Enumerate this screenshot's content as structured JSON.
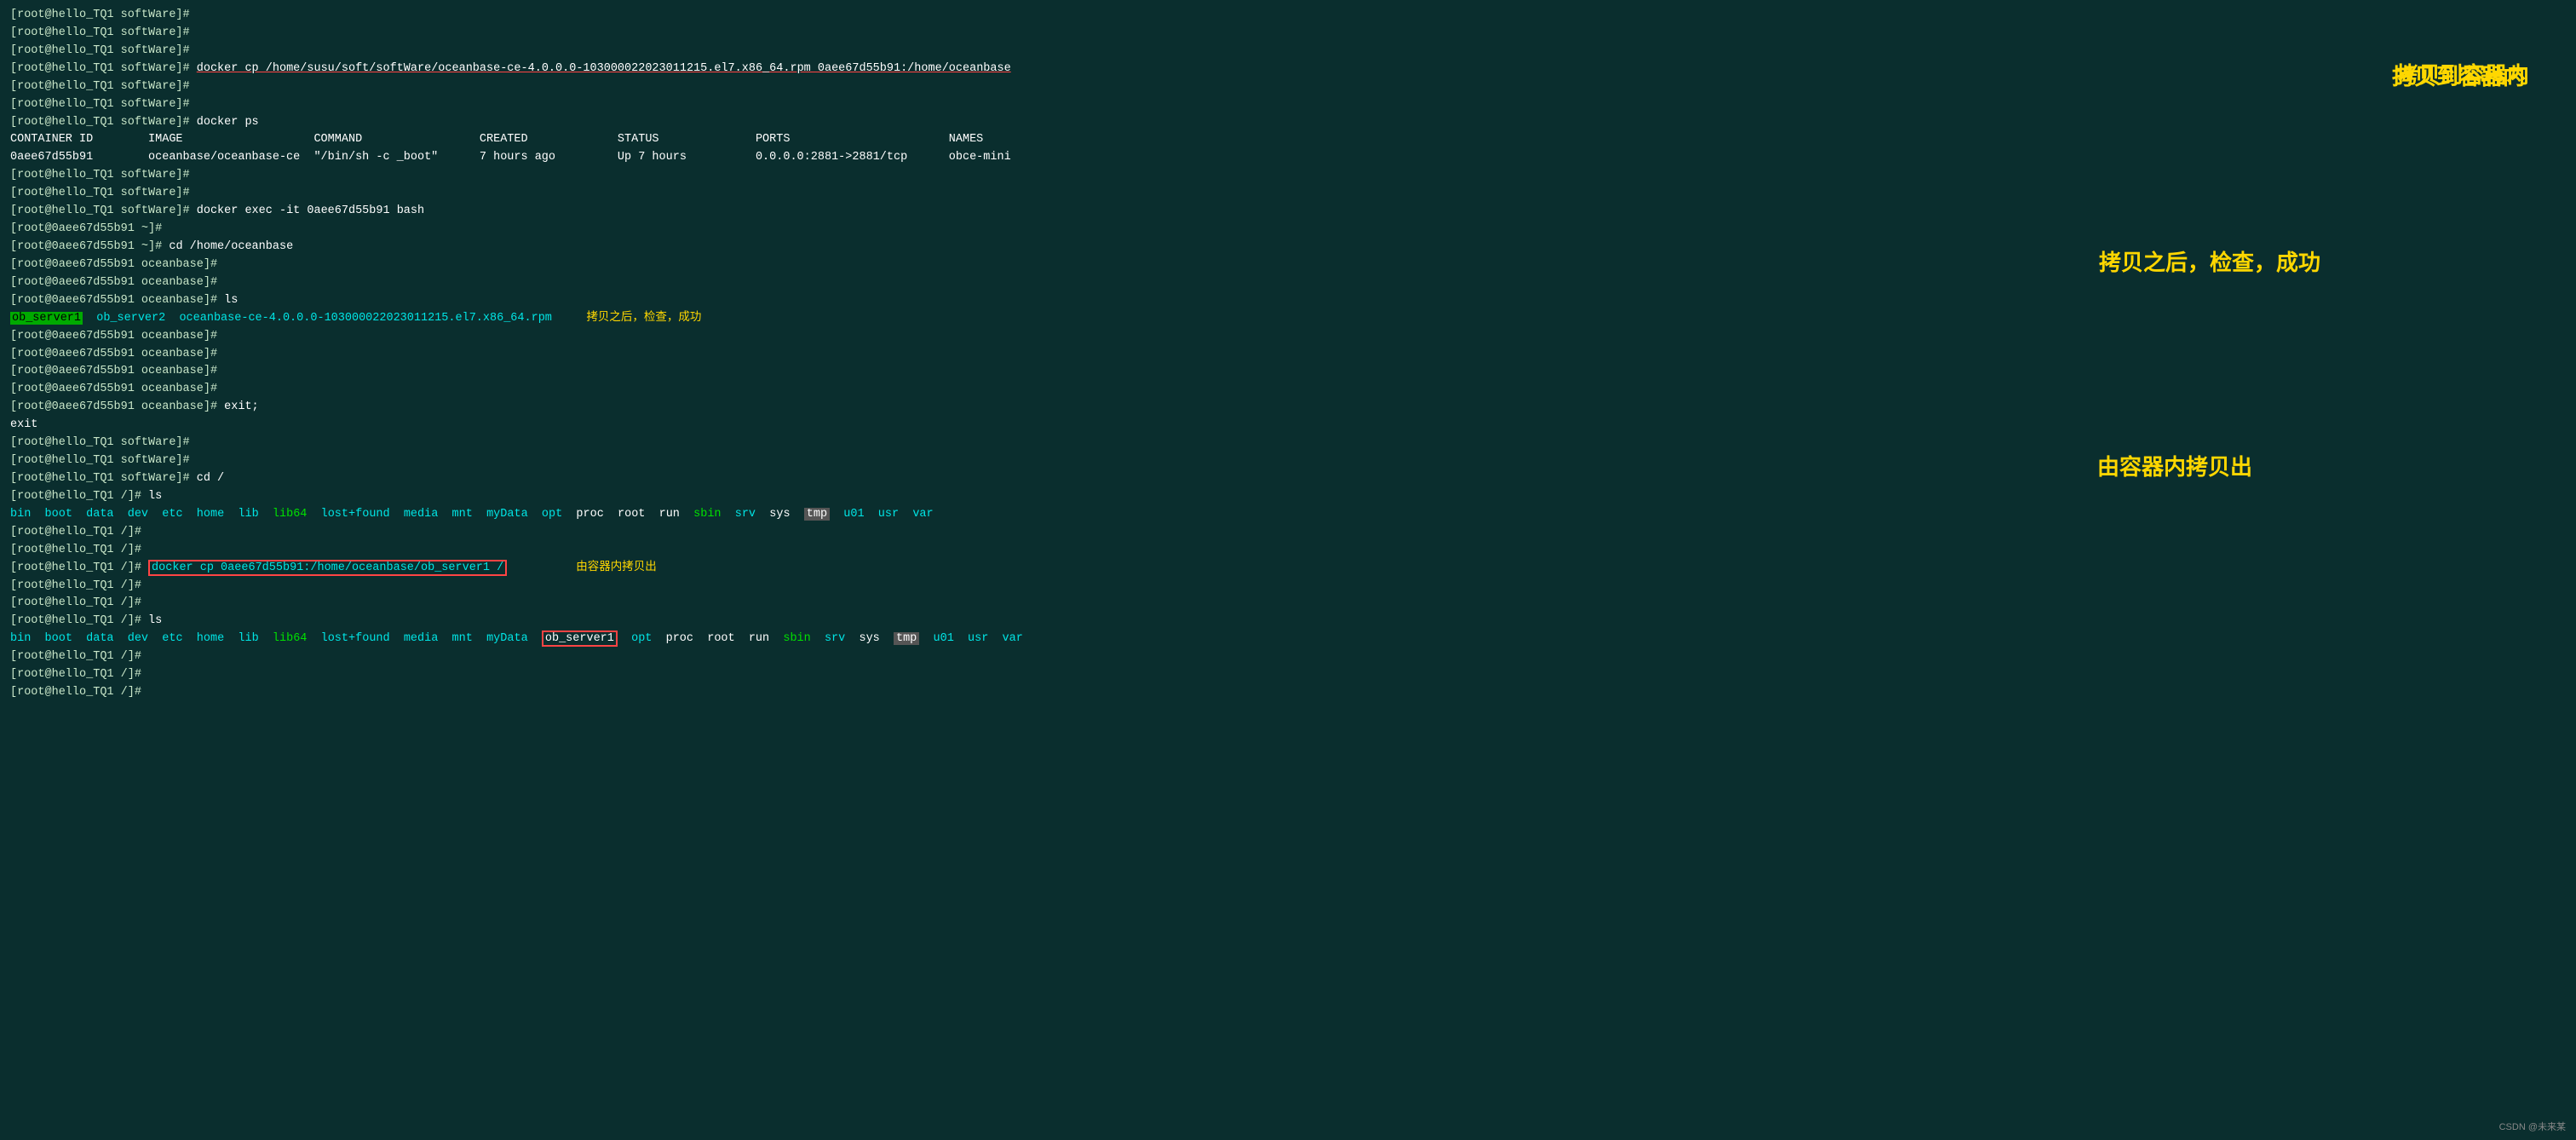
{
  "terminal": {
    "bg": "#0a2e2e",
    "lines": []
  },
  "annotations": {
    "copy_to_container": "拷贝到容器内",
    "copy_check_success": "拷贝之后，检查，成功",
    "copy_from_container": "由容器内拷贝出"
  },
  "watermark": "CSDN @未来某",
  "docker_ps": {
    "container_id": "0aee67d55b91",
    "image": "oceanbase/oceanbase-ce",
    "command": "\"/bin/sh -c _boot\"",
    "created": "7 hours ago",
    "status": "Up 7 hours",
    "ports": "0.0.0.0:2881->2881/tcp",
    "names": "obce-mini"
  }
}
